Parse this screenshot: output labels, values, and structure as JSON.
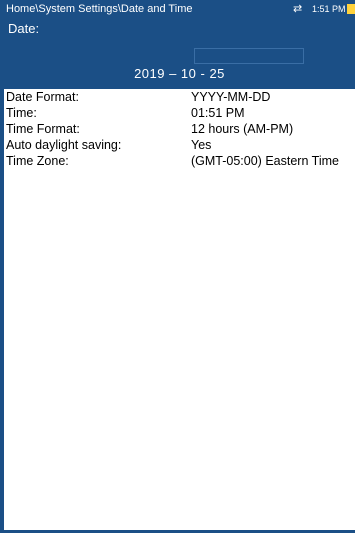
{
  "header": {
    "breadcrumb": "Home\\System Settings\\Date and Time",
    "time": "1:51 PM",
    "network_icon": "network-transfer-icon",
    "battery_icon": "battery-icon"
  },
  "date_section": {
    "label": "Date:",
    "value": "2019 – 10 - 25"
  },
  "settings": [
    {
      "label": "Date Format:",
      "value": "YYYY-MM-DD"
    },
    {
      "label": "Time:",
      "value": "01:51 PM"
    },
    {
      "label": "Time Format:",
      "value": "12 hours (AM-PM)"
    },
    {
      "label": "Auto daylight saving:",
      "value": "Yes"
    },
    {
      "label": "Time Zone:",
      "value": "(GMT-05:00) Eastern Time"
    }
  ],
  "colors": {
    "header_bg": "#1b4f86",
    "header_text": "#ffffff",
    "battery": "#ffd23c"
  }
}
